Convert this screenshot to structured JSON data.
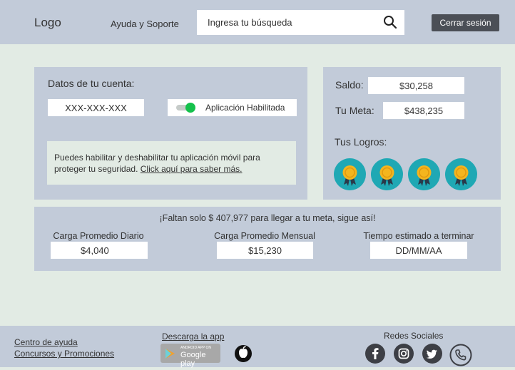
{
  "header": {
    "logo": "Logo",
    "help_label": "Ayuda y Soporte",
    "search_value": "Ingresa tu búsqueda",
    "logout_label": "Cerrar sesión"
  },
  "account": {
    "title": "Datos de tu cuenta:",
    "account_number": "XXX-XXX-XXX",
    "app_toggle_label": "Aplicación Habilitada",
    "info_text": "Puedes habilitar y deshabilitar tu aplicación móvil para proteger tu seguridad.",
    "info_link": "Click aquí para saber más."
  },
  "balance": {
    "saldo_label": "Saldo:",
    "saldo_value": "$30,258",
    "meta_label": "Tu Meta:",
    "meta_value": "$438,235",
    "logros_label": "Tus Logros:",
    "achievements": [
      "medal-icon",
      "medal-icon",
      "medal-icon",
      "medal-icon"
    ]
  },
  "stats": {
    "message": "¡Faltan solo $ 407,977 para llegar a tu meta, sigue así!",
    "daily_label": "Carga Promedio Diario",
    "daily_value": "$4,040",
    "monthly_label": "Carga Promedio Mensual",
    "monthly_value": "$15,230",
    "time_label": "Tiempo estimado a terminar",
    "time_value": "DD/MM/AA"
  },
  "footer": {
    "help_center": "Centro de ayuda",
    "contests": "Concursos y Promociones",
    "download_label": "Descarga la app",
    "gplay_small": "ANDROID APP ON",
    "gplay_big": "Google play",
    "social_label": "Redes Sociales"
  },
  "colors": {
    "panel": "#c2cbd9",
    "background": "#e2ebe4",
    "toggle_on": "#15c14c",
    "badge": "#1fa8b4",
    "medal": "#f4b51e"
  }
}
